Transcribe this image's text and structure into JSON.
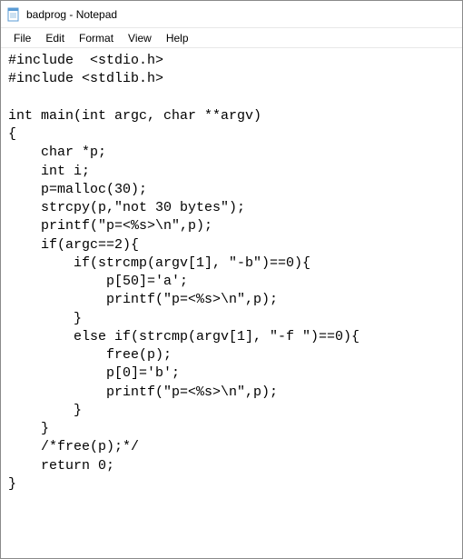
{
  "window": {
    "title": "badprog - Notepad"
  },
  "menubar": {
    "items": [
      "File",
      "Edit",
      "Format",
      "View",
      "Help"
    ]
  },
  "editor": {
    "content": "#include  <stdio.h>\n#include <stdlib.h>\n\nint main(int argc, char **argv)\n{\n    char *p;\n    int i;\n    p=malloc(30);\n    strcpy(p,\"not 30 bytes\");\n    printf(\"p=<%s>\\n\",p);\n    if(argc==2){\n        if(strcmp(argv[1], \"-b\")==0){\n            p[50]='a';\n            printf(\"p=<%s>\\n\",p);\n        }\n        else if(strcmp(argv[1], \"-f \")==0){\n            free(p);\n            p[0]='b';\n            printf(\"p=<%s>\\n\",p);\n        }\n    }\n    /*free(p);*/\n    return 0;\n}"
  }
}
